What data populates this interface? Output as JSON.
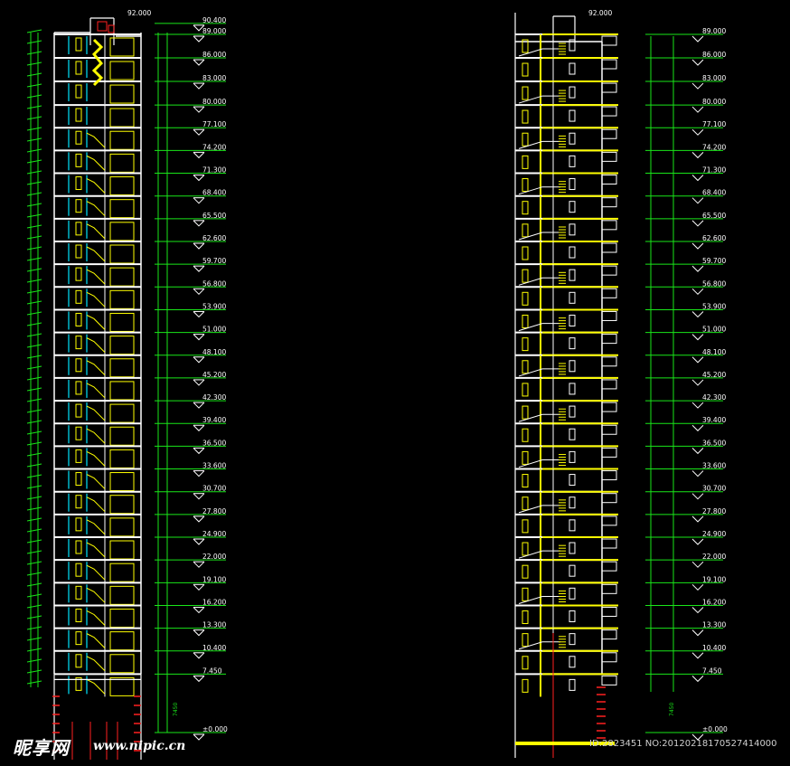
{
  "drawing": {
    "top_elevation": "92.000",
    "left_section": {
      "levels": [
        "90.400",
        "89.000",
        "86.000",
        "83.000",
        "80.000",
        "77.100",
        "74.200",
        "71.300",
        "68.400",
        "65.500",
        "62.600",
        "59.700",
        "56.800",
        "53.900",
        "51.000",
        "48.100",
        "45.200",
        "42.300",
        "39.400",
        "36.500",
        "33.600",
        "30.700",
        "27.800",
        "24.900",
        "22.000",
        "19.100",
        "16.200",
        "13.300",
        "10.400",
        "7.450",
        "±0.000"
      ]
    },
    "right_section": {
      "levels": [
        "89.000",
        "86.000",
        "83.000",
        "80.000",
        "77.100",
        "74.200",
        "71.300",
        "68.400",
        "65.500",
        "62.600",
        "59.700",
        "56.800",
        "53.900",
        "51.000",
        "48.100",
        "45.200",
        "42.300",
        "39.400",
        "36.500",
        "33.600",
        "30.700",
        "27.800",
        "24.900",
        "22.000",
        "19.100",
        "16.200",
        "13.300",
        "10.400",
        "7.450",
        "±0.000"
      ]
    },
    "base_dimension": "7450"
  },
  "watermark": {
    "brand": "昵享网",
    "url": "www.nipic.cn",
    "id_text": "ID:2823451 NO:20120218170527414000"
  },
  "colors": {
    "background": "#000000",
    "wall": "#ffffff",
    "dimension": "#19e619",
    "stair": "#ffff00",
    "glazing": "#00e5ff",
    "column": "#ff2020"
  }
}
